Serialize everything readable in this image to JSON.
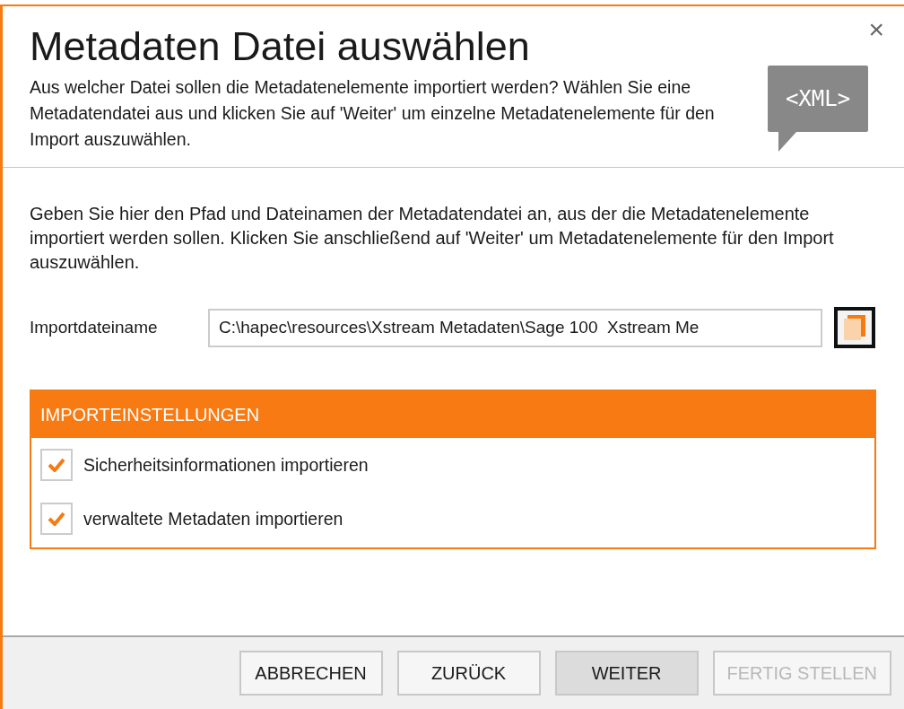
{
  "dialog": {
    "title": "Metadaten Datei auswählen",
    "subtitle": "Aus welcher Datei sollen die Metadatenelemente importiert werden? Wählen Sie eine Metadatendatei aus und klicken Sie auf 'Weiter' um einzelne Metadatenelemente für den Import auszuwählen.",
    "badge": "<XML>",
    "close": "×",
    "instructions": "Geben Sie hier den Pfad und Dateinamen der Metadatendatei an, aus der die Metadatenelemente importiert werden sollen. Klicken Sie anschließend auf 'Weiter' um Metadatenelemente für den Import auszuwählen.",
    "file_field": {
      "label": "Importdateiname",
      "value": "C:\\hapec\\resources\\Xstream Metadaten\\Sage 100  Xstream Me"
    },
    "settings": {
      "title": "IMPORTEINSTELLUNGEN",
      "options": [
        {
          "label": "Sicherheitsinformationen importieren",
          "checked": true
        },
        {
          "label": "verwaltete Metadaten importieren",
          "checked": true
        }
      ]
    },
    "buttons": [
      {
        "label": "ABBRECHEN",
        "highlighted": false,
        "disabled": false
      },
      {
        "label": "ZURÜCK",
        "highlighted": false,
        "disabled": false
      },
      {
        "label": "WEITER",
        "highlighted": true,
        "disabled": false
      },
      {
        "label": "FERTIG STELLEN",
        "highlighted": false,
        "disabled": true
      }
    ]
  }
}
